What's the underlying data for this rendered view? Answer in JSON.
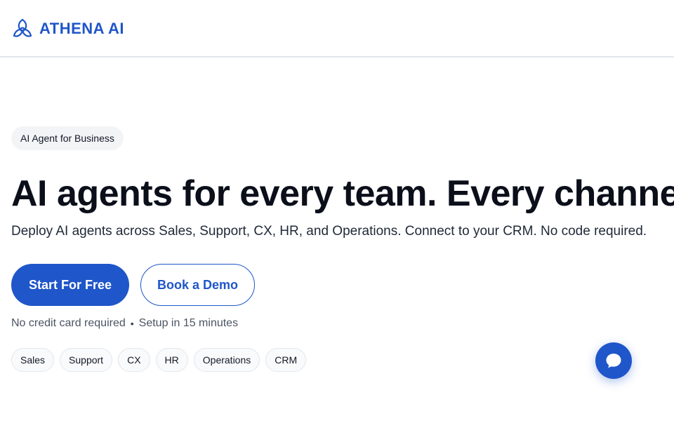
{
  "header": {
    "brand": "ATHENA AI",
    "brand_color": "#1f56c9"
  },
  "hero": {
    "badge": "AI Agent for Business",
    "headline": "AI agents for every team. Every channel.",
    "subhead": "Deploy AI agents across Sales, Support, CX, HR, and Operations. Connect to your CRM. No code required.",
    "primary_cta": "Start For Free",
    "secondary_cta": "Book a Demo",
    "note_left": "No credit card required",
    "note_separator": "•",
    "note_right": "Setup in 15 minutes",
    "chips": [
      "Sales",
      "Support",
      "CX",
      "HR",
      "Operations",
      "CRM"
    ]
  },
  "chat_widget": {
    "icon": "chat-bubble-icon"
  }
}
